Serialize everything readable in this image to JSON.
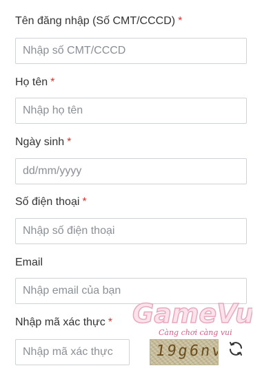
{
  "fields": {
    "username": {
      "label": "Tên đăng nhập (Số CMT/CCCD)",
      "required": "*",
      "placeholder": "Nhập số CMT/CCCD"
    },
    "fullname": {
      "label": "Họ tên",
      "required": "*",
      "placeholder": "Nhập họ tên"
    },
    "birthday": {
      "label": "Ngày sinh",
      "required": "*",
      "placeholder": "dd/mm/yyyy"
    },
    "phone": {
      "label": "Số điện thoại",
      "required": "*",
      "placeholder": "Nhập số điện thoại"
    },
    "email": {
      "label": "Email",
      "placeholder": "Nhập email của bạn"
    },
    "captcha": {
      "label": "Nhập mã xác thực",
      "required": "*",
      "placeholder": "Nhập mã xác thực",
      "code": "19g6nv"
    }
  },
  "icons": {
    "refresh": "refresh-icon"
  },
  "watermark": {
    "brand": "GameVui",
    "tagline": "Càng chơi càng vui"
  },
  "colors": {
    "required": "#e03030",
    "text": "#333333",
    "border": "#cfd3d8",
    "placeholder": "#8a8f95"
  }
}
